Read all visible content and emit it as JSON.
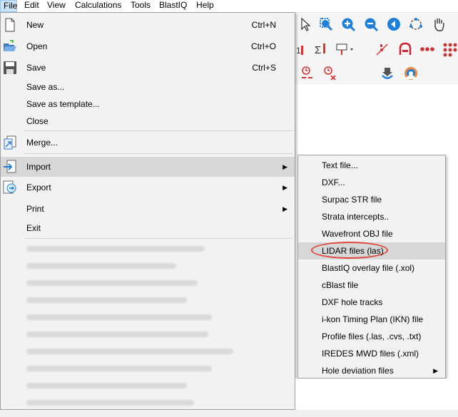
{
  "menubar": {
    "items": [
      {
        "label": "File"
      },
      {
        "label": "Edit"
      },
      {
        "label": "View"
      },
      {
        "label": "Calculations"
      },
      {
        "label": "Tools"
      },
      {
        "label": "BlastIQ"
      },
      {
        "label": "Help"
      }
    ]
  },
  "file_menu": {
    "items": [
      {
        "label": "New",
        "shortcut": "Ctrl+N",
        "icon": "new-file-icon"
      },
      {
        "label": "Open",
        "shortcut": "Ctrl+O",
        "icon": "open-folder-icon"
      },
      {
        "label": "Save",
        "shortcut": "Ctrl+S",
        "icon": "save-disk-icon"
      },
      {
        "label": "Save as..."
      },
      {
        "label": "Save as template..."
      },
      {
        "label": "Close"
      },
      {
        "label": "Merge...",
        "icon": "merge-icon"
      },
      {
        "label": "Import",
        "icon": "import-icon",
        "has_submenu": true,
        "highlighted": true
      },
      {
        "label": "Export",
        "icon": "export-icon",
        "has_submenu": true
      },
      {
        "label": "Print",
        "has_submenu": true
      },
      {
        "label": "Exit"
      }
    ],
    "recent_files_blurred": true
  },
  "import_submenu": {
    "items": [
      {
        "label": "Text file..."
      },
      {
        "label": "DXF..."
      },
      {
        "label": "Surpac STR file"
      },
      {
        "label": "Strata intercepts.."
      },
      {
        "label": "Wavefront OBJ file"
      },
      {
        "label": "LIDAR files (las)",
        "highlighted": true,
        "circled": true
      },
      {
        "label": "BlastIQ overlay file (.xol)"
      },
      {
        "label": "cBlast file"
      },
      {
        "label": "DXF hole tracks"
      },
      {
        "label": "i-kon Timing Plan (IKN) file"
      },
      {
        "label": "Profile files (.las, .cvs, .txt)"
      },
      {
        "label": "IREDES MWD files (.xml)"
      },
      {
        "label": "Hole deviation files",
        "has_submenu": true
      }
    ]
  },
  "colors": {
    "menu_bg": "#f2f2f2",
    "highlight": "#d7d7d7",
    "annotation": "#e0463a",
    "toolbar_blue": "#1e7fd8"
  }
}
